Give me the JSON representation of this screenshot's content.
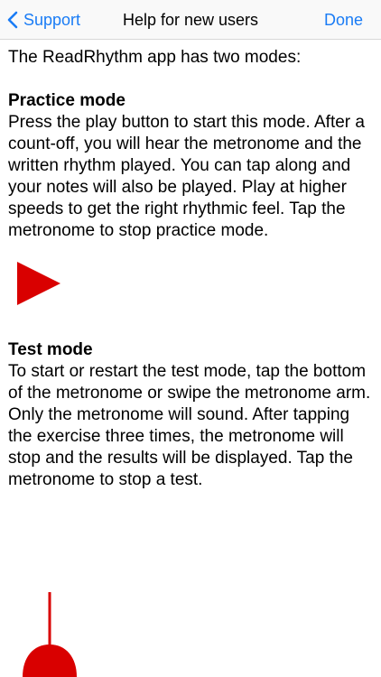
{
  "navbar": {
    "back_label": "Support",
    "title": "Help for new users",
    "done_label": "Done"
  },
  "content": {
    "intro": "The ReadRhythm app has two modes:",
    "practice": {
      "heading": "Practice mode",
      "body": "Press the play button to start this mode. After a count-off, you will hear the metronome and the written rhythm played. You can tap along and your notes will also be played. Play at higher speeds to get the right rhythmic feel. Tap the metronome to stop practice mode."
    },
    "test": {
      "heading": "Test mode",
      "body": "To start or restart the test mode, tap the bottom of the metronome or swipe the metronome arm. Only the metronome will sound. After tapping the exercise three times, the metronome will stop and the results will be displayed. Tap the metronome to stop a test."
    }
  },
  "icons": {
    "back": "chevron-left-icon",
    "play": "play-icon",
    "metronome": "metronome-icon"
  },
  "colors": {
    "accent": "#1a7cf5",
    "icon_red": "#d90000"
  }
}
